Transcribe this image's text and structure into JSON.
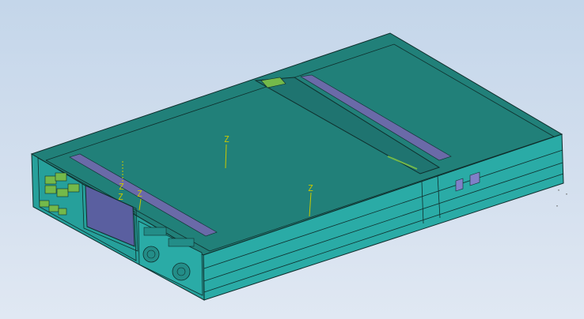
{
  "viewport": {
    "background_top": "#c4d6ea",
    "background_bottom": "#e0e8f3"
  },
  "model": {
    "top_face_color": "#218079",
    "front_face_color": "#2aaba6",
    "side_face_color": "#26a09b",
    "edge_color": "#0f2d2b",
    "slot_color": "#6a6aa8",
    "highlight_color": "#74b94a",
    "display_panel_color": "#5a5fa0"
  },
  "annotations": {
    "z1": "Z",
    "z2": "Z",
    "z3": "Z",
    "z4": "Z",
    "z5": "Z"
  },
  "triad": {
    "glyph": "·"
  }
}
